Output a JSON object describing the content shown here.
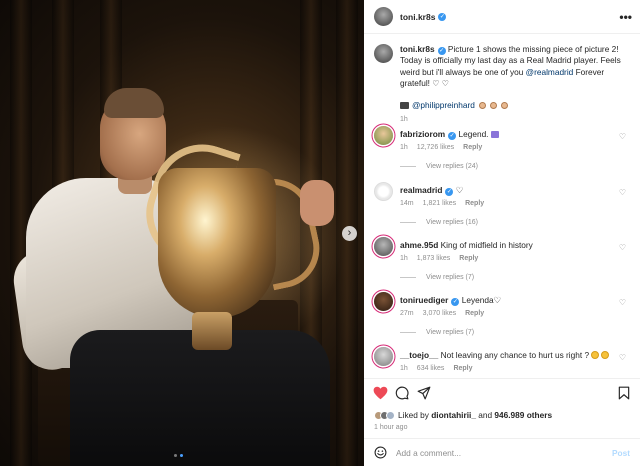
{
  "post": {
    "username": "toni.kr8s",
    "more_label": "•••",
    "next_label": "›"
  },
  "caption": {
    "username": "toni.kr8s",
    "text_1": "Picture 1 shows the missing piece of picture 2! Today is officially my last day as a Real Madrid player. Feels weird but i'll always be one of you",
    "mention": "@realmadrid",
    "text_2": "Forever grateful!",
    "hearts_end": "♡ ♡",
    "credit": "@philippreinhard",
    "time": "1h"
  },
  "comments": [
    {
      "username": "fabriziorom",
      "text": "Legend.",
      "time": "1h",
      "likes": "12,726 likes",
      "reply": "Reply",
      "views": "View replies (24)",
      "verified": true,
      "emoji": "box"
    },
    {
      "username": "realmadrid",
      "text": "♡",
      "time": "14m",
      "likes": "1,821 likes",
      "reply": "Reply",
      "views": "View replies (16)",
      "verified": true,
      "emoji": ""
    },
    {
      "username": "ahme.95d",
      "text": "King of midfield in history",
      "time": "1h",
      "likes": "1,873 likes",
      "reply": "Reply",
      "views": "View replies (7)",
      "verified": false,
      "emoji": ""
    },
    {
      "username": "toniruediger",
      "text": "Leyenda♡",
      "time": "27m",
      "likes": "3,070 likes",
      "reply": "Reply",
      "views": "View replies (7)",
      "verified": true,
      "emoji": ""
    },
    {
      "username": "__toejo__",
      "text": "Not leaving any chance to hurt us right ?",
      "time": "1h",
      "likes": "634 likes",
      "reply": "Reply",
      "views": "",
      "verified": false,
      "emoji": "faces"
    }
  ],
  "actions": {
    "liked_by_prefix": "Liked by",
    "liked_by_user": "diontahirii_",
    "liked_by_and": "and",
    "likes_count": "946.989 others",
    "time": "1 hour ago"
  },
  "add_comment": {
    "placeholder": "Add a comment...",
    "post_label": "Post"
  },
  "icons": [
    "heart-icon",
    "comment-icon",
    "share-icon",
    "bookmark-icon",
    "emoji-icon",
    "verified-icon",
    "more-icon",
    "chevron-right-icon"
  ],
  "colors": {
    "verified": "#3897f0",
    "liked_heart": "#ed4956",
    "link": "#00376b",
    "muted": "#8e8e8e",
    "carousel_dot_active": "#4aa0ff"
  }
}
